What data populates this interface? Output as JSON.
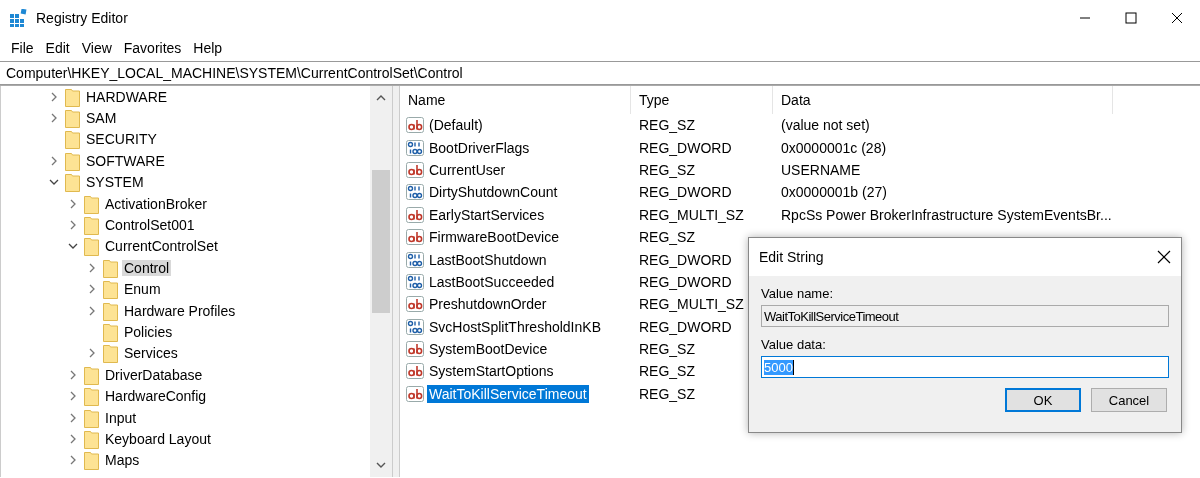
{
  "window": {
    "title": "Registry Editor"
  },
  "menu": [
    "File",
    "Edit",
    "View",
    "Favorites",
    "Help"
  ],
  "address": "Computer\\HKEY_LOCAL_MACHINE\\SYSTEM\\CurrentControlSet\\Control",
  "tree": [
    {
      "label": "HARDWARE",
      "leaf": false,
      "expanded": false,
      "selected": false
    },
    {
      "label": "SAM",
      "leaf": false,
      "expanded": false,
      "selected": false
    },
    {
      "label": "SECURITY",
      "leaf": true,
      "expanded": false,
      "selected": false
    },
    {
      "label": "SOFTWARE",
      "leaf": false,
      "expanded": false,
      "selected": false
    },
    {
      "label": "SYSTEM",
      "leaf": false,
      "expanded": true,
      "selected": false,
      "children": [
        {
          "label": "ActivationBroker",
          "leaf": false,
          "expanded": false,
          "selected": false
        },
        {
          "label": "ControlSet001",
          "leaf": false,
          "expanded": false,
          "selected": false
        },
        {
          "label": "CurrentControlSet",
          "leaf": false,
          "expanded": true,
          "selected": false,
          "children": [
            {
              "label": "Control",
              "leaf": false,
              "expanded": false,
              "selected": true
            },
            {
              "label": "Enum",
              "leaf": false,
              "expanded": false,
              "selected": false
            },
            {
              "label": "Hardware Profiles",
              "leaf": false,
              "expanded": false,
              "selected": false
            },
            {
              "label": "Policies",
              "leaf": true,
              "expanded": false,
              "selected": false
            },
            {
              "label": "Services",
              "leaf": false,
              "expanded": false,
              "selected": false
            }
          ]
        },
        {
          "label": "DriverDatabase",
          "leaf": false,
          "expanded": false,
          "selected": false
        },
        {
          "label": "HardwareConfig",
          "leaf": false,
          "expanded": false,
          "selected": false
        },
        {
          "label": "Input",
          "leaf": false,
          "expanded": false,
          "selected": false
        },
        {
          "label": "Keyboard Layout",
          "leaf": false,
          "expanded": false,
          "selected": false
        },
        {
          "label": "Maps",
          "leaf": false,
          "expanded": false,
          "selected": false
        }
      ]
    }
  ],
  "values": {
    "columns": [
      "Name",
      "Type",
      "Data"
    ],
    "rows": [
      {
        "kind": "string",
        "name": "(Default)",
        "type": "REG_SZ",
        "data": "(value not set)",
        "selected": false
      },
      {
        "kind": "binary",
        "name": "BootDriverFlags",
        "type": "REG_DWORD",
        "data": "0x0000001c (28)",
        "selected": false
      },
      {
        "kind": "string",
        "name": "CurrentUser",
        "type": "REG_SZ",
        "data": "USERNAME",
        "selected": false
      },
      {
        "kind": "binary",
        "name": "DirtyShutdownCount",
        "type": "REG_DWORD",
        "data": "0x0000001b (27)",
        "selected": false
      },
      {
        "kind": "string",
        "name": "EarlyStartServices",
        "type": "REG_MULTI_SZ",
        "data": "RpcSs Power BrokerInfrastructure SystemEventsBr...",
        "selected": false
      },
      {
        "kind": "string",
        "name": "FirmwareBootDevice",
        "type": "REG_SZ",
        "selected": false
      },
      {
        "kind": "binary",
        "name": "LastBootShutdown",
        "type": "REG_DWORD",
        "selected": false
      },
      {
        "kind": "binary",
        "name": "LastBootSucceeded",
        "type": "REG_DWORD",
        "selected": false
      },
      {
        "kind": "string",
        "name": "PreshutdownOrder",
        "type": "REG_MULTI_SZ",
        "selected": false
      },
      {
        "kind": "binary",
        "name": "SvcHostSplitThresholdInKB",
        "type": "REG_DWORD",
        "selected": false
      },
      {
        "kind": "string",
        "name": "SystemBootDevice",
        "type": "REG_SZ",
        "selected": false
      },
      {
        "kind": "string",
        "name": "SystemStartOptions",
        "type": "REG_SZ",
        "selected": false
      },
      {
        "kind": "string",
        "name": "WaitToKillServiceTimeout",
        "type": "REG_SZ",
        "selected": true
      }
    ]
  },
  "dialog": {
    "title": "Edit String",
    "name_label": "Value name:",
    "name_value": "WaitToKillServiceTimeout",
    "data_label": "Value data:",
    "data_value": "5000",
    "buttons": [
      {
        "label": "OK",
        "default": true
      },
      {
        "label": "Cancel",
        "default": false
      }
    ]
  }
}
